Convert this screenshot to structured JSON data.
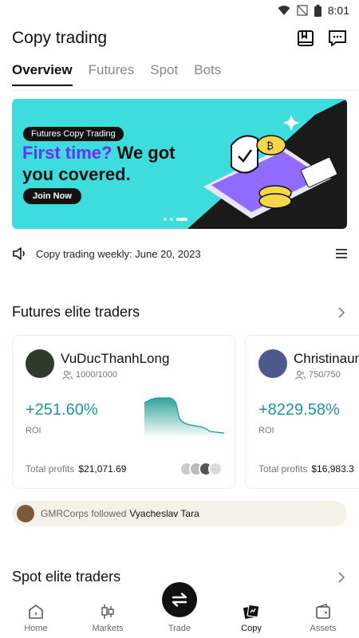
{
  "status_bar": {
    "time": "8:01"
  },
  "header": {
    "title": "Copy trading"
  },
  "tabs": [
    {
      "label": "Overview"
    },
    {
      "label": "Futures"
    },
    {
      "label": "Spot"
    },
    {
      "label": "Bots"
    }
  ],
  "banner": {
    "tag": "Futures Copy Trading",
    "headline_highlight": "First time?",
    "headline_rest": " We got",
    "headline_line2": "you covered.",
    "button": "Join Now",
    "colors": {
      "background": "#3edddd",
      "highlight": "#6b2eff"
    }
  },
  "announcement": {
    "text": "Copy trading weekly: June 20, 2023"
  },
  "futures_section": {
    "title": "Futures elite traders"
  },
  "traders": [
    {
      "name": "VuDucThanhLong",
      "followers": "1000/1000",
      "roi": "+251.60%",
      "roi_label": "ROI",
      "total_profits_label": "Total profits",
      "total_profits": "$21,071.69"
    },
    {
      "name": "Christinaun",
      "followers": "750/750",
      "roi": "+8229.58%",
      "roi_label": "ROI",
      "total_profits_label": "Total profits",
      "total_profits": "$16,983.3"
    }
  ],
  "follow_feed": {
    "actor": "GMRCorps followed",
    "target": "Vyacheslav Tara"
  },
  "spot_section": {
    "title": "Spot elite traders"
  },
  "bottom_nav": [
    {
      "label": "Home",
      "icon": "home-icon"
    },
    {
      "label": "Markets",
      "icon": "candlestick-icon"
    },
    {
      "label": "Trade",
      "icon": "swap-icon"
    },
    {
      "label": "Copy",
      "icon": "copy-cards-icon"
    },
    {
      "label": "Assets",
      "icon": "wallet-icon"
    }
  ],
  "accent_color": "#1a9a8f"
}
